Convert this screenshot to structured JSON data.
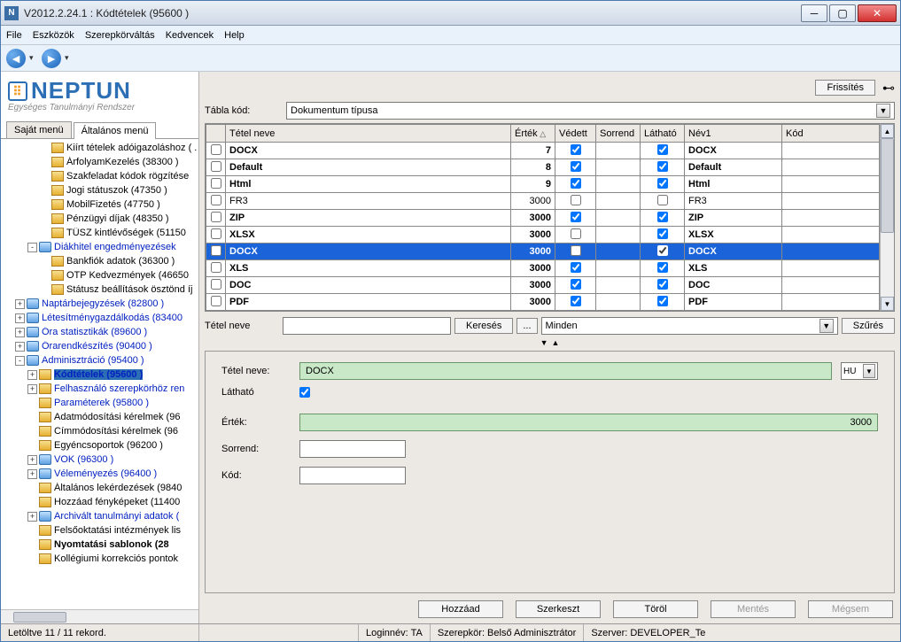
{
  "window": {
    "title": "V2012.2.24.1 : Kódtételek (95600  )"
  },
  "menubar": [
    "File",
    "Eszközök",
    "Szerepkörváltás",
    "Kedvencek",
    "Help"
  ],
  "logo": {
    "main": "NEPTUN",
    "sub": "Egységes Tanulmányi Rendszer"
  },
  "menutabs": {
    "a": "Saját menü",
    "b": "Általános menü"
  },
  "tree": [
    {
      "ind": 2,
      "exp": "",
      "ico": "f",
      "t": "Kiírt tételek adóigazoláshoz ( .",
      "blue": false,
      "bold": false
    },
    {
      "ind": 2,
      "exp": "",
      "ico": "f",
      "t": "ÁrfolyamKezelés (38300  )",
      "blue": false
    },
    {
      "ind": 2,
      "exp": "",
      "ico": "f",
      "t": "Szakfeladat kódok rögzítése",
      "blue": false
    },
    {
      "ind": 2,
      "exp": "",
      "ico": "f",
      "t": "Jogi státuszok (47350  )",
      "blue": false
    },
    {
      "ind": 2,
      "exp": "",
      "ico": "f",
      "t": "MobilFizetés (47750  )",
      "blue": false
    },
    {
      "ind": 2,
      "exp": "",
      "ico": "f",
      "t": "Pénzügyi díjak (48350  )",
      "blue": false
    },
    {
      "ind": 2,
      "exp": "",
      "ico": "f",
      "t": "TÜSZ kintlévőségek (51150",
      "blue": false
    },
    {
      "ind": 1,
      "exp": "-",
      "ico": "db",
      "t": "Diákhitel engedményezések",
      "blue": true
    },
    {
      "ind": 2,
      "exp": "",
      "ico": "f",
      "t": "Bankfiók adatok (36300  )",
      "blue": false
    },
    {
      "ind": 2,
      "exp": "",
      "ico": "f",
      "t": "OTP Kedvezmények (46650",
      "blue": false
    },
    {
      "ind": 2,
      "exp": "",
      "ico": "f",
      "t": "Státusz beállítások ösztönd íj",
      "blue": false
    },
    {
      "ind": 0,
      "exp": "+",
      "ico": "db",
      "t": "Naptárbejegyzések (82800  )",
      "blue": true
    },
    {
      "ind": 0,
      "exp": "+",
      "ico": "db",
      "t": "Létesítménygazdálkodás (83400",
      "blue": true
    },
    {
      "ind": 0,
      "exp": "+",
      "ico": "db",
      "t": "Óra statisztikák (89600  )",
      "blue": true
    },
    {
      "ind": 0,
      "exp": "+",
      "ico": "db",
      "t": "Órarendkészítés (90400  )",
      "blue": true
    },
    {
      "ind": 0,
      "exp": "-",
      "ico": "db",
      "t": "Adminisztráció (95400  )",
      "blue": true
    },
    {
      "ind": 1,
      "exp": "+",
      "ico": "f",
      "t": "Kódtételek (95600  )",
      "blue": true,
      "bold": true,
      "sel": true
    },
    {
      "ind": 1,
      "exp": "+",
      "ico": "f",
      "t": "Felhasználó szerepkörhöz ren",
      "blue": true
    },
    {
      "ind": 1,
      "exp": "",
      "ico": "f",
      "t": "Paraméterek (95800  )",
      "blue": true
    },
    {
      "ind": 1,
      "exp": "",
      "ico": "f",
      "t": "Adatmódosítási kérelmek (96",
      "blue": false
    },
    {
      "ind": 1,
      "exp": "",
      "ico": "f",
      "t": "Címmódosítási kérelmek (96",
      "blue": false
    },
    {
      "ind": 1,
      "exp": "",
      "ico": "f",
      "t": "Egyéncsoportok (96200  )",
      "blue": false
    },
    {
      "ind": 1,
      "exp": "+",
      "ico": "db",
      "t": "VOK (96300  )",
      "blue": true
    },
    {
      "ind": 1,
      "exp": "+",
      "ico": "db",
      "t": "Véleményezés (96400  )",
      "blue": true
    },
    {
      "ind": 1,
      "exp": "",
      "ico": "f",
      "t": "Általános lekérdezések (9840",
      "blue": false
    },
    {
      "ind": 1,
      "exp": "",
      "ico": "f",
      "t": "Hozzáad fényképeket (11400",
      "blue": false
    },
    {
      "ind": 1,
      "exp": "+",
      "ico": "db",
      "t": "Archivált tanulmányi adatok (",
      "blue": true
    },
    {
      "ind": 1,
      "exp": "",
      "ico": "f",
      "t": "Felsőoktatási intézmények lis",
      "blue": false
    },
    {
      "ind": 1,
      "exp": "",
      "ico": "f",
      "t": "Nyomtatási sablonok (28",
      "blue": false,
      "bold": true
    },
    {
      "ind": 1,
      "exp": "",
      "ico": "f",
      "t": "Kollégiumi korrekciós pontok",
      "blue": false
    }
  ],
  "top": {
    "refresh": "Frissítés"
  },
  "table_combo": {
    "label": "Tábla kód:",
    "value": "Dokumentum típusa"
  },
  "grid": {
    "headers": {
      "name": "Tétel neve",
      "value": "Érték",
      "protected": "Védett",
      "order": "Sorrend",
      "visible": "Látható",
      "name1": "Név1",
      "code": "Kód"
    },
    "rows": [
      {
        "name": "DOCX",
        "value": "7",
        "prot": true,
        "ord": "",
        "vis": true,
        "name1": "DOCX",
        "code": ""
      },
      {
        "name": "Default",
        "value": "8",
        "prot": true,
        "ord": "",
        "vis": true,
        "name1": "Default",
        "code": ""
      },
      {
        "name": "Html",
        "value": "9",
        "prot": true,
        "ord": "",
        "vis": true,
        "name1": "Html",
        "code": ""
      },
      {
        "name": "FR3",
        "value": "3000",
        "prot": false,
        "ord": "",
        "vis": false,
        "name1": "FR3",
        "code": ""
      },
      {
        "name": "ZIP",
        "value": "3000",
        "prot": true,
        "ord": "",
        "vis": true,
        "name1": "ZIP",
        "code": ""
      },
      {
        "name": "XLSX",
        "value": "3000",
        "prot": false,
        "ord": "",
        "vis": true,
        "name1": "XLSX",
        "code": ""
      },
      {
        "name": "DOCX",
        "value": "3000",
        "prot": false,
        "ord": "",
        "vis": true,
        "name1": "DOCX",
        "code": "",
        "sel": true
      },
      {
        "name": "XLS",
        "value": "3000",
        "prot": true,
        "ord": "",
        "vis": true,
        "name1": "XLS",
        "code": ""
      },
      {
        "name": "DOC",
        "value": "3000",
        "prot": true,
        "ord": "",
        "vis": true,
        "name1": "DOC",
        "code": ""
      },
      {
        "name": "PDF",
        "value": "3000",
        "prot": true,
        "ord": "",
        "vis": true,
        "name1": "PDF",
        "code": ""
      }
    ]
  },
  "search": {
    "label": "Tétel neve",
    "btn_search": "Keresés",
    "btn_browse": "...",
    "filter_value": "Minden",
    "btn_filter": "Szűrés"
  },
  "detail": {
    "name_label": "Tétel neve:",
    "name_value": "DOCX",
    "visible_label": "Látható",
    "visible_value": true,
    "value_label": "Érték:",
    "value_value": "3000",
    "order_label": "Sorrend:",
    "order_value": "",
    "code_label": "Kód:",
    "code_value": "",
    "lang": "HU"
  },
  "bottom_buttons": {
    "add": "Hozzáad",
    "edit": "Szerkeszt",
    "delete": "Töröl",
    "save": "Mentés",
    "cancel": "Mégsem"
  },
  "status": {
    "records": "Letöltve 11 / 11 rekord.",
    "login": "Loginnév: TA",
    "role": "Szerepkör: Belső Adminisztrátor",
    "server": "Szerver: DEVELOPER_Te"
  }
}
